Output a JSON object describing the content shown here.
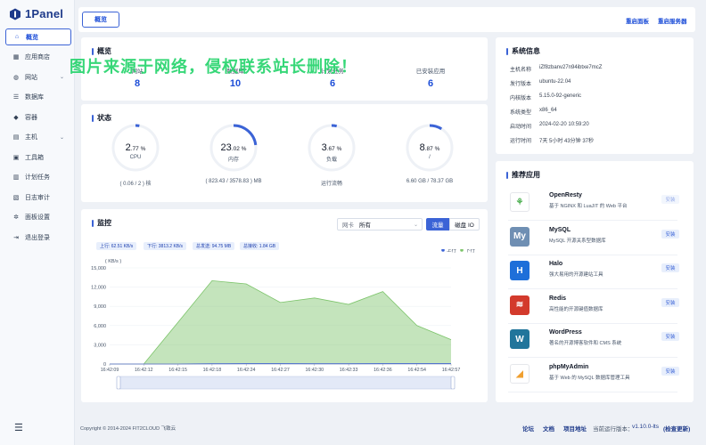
{
  "brand": {
    "name": "1Panel",
    "accent": "#3b63d6"
  },
  "sidebar": {
    "items": [
      {
        "label": "概览",
        "icon": "home-icon",
        "active": true
      },
      {
        "label": "应用商店",
        "icon": "store-icon"
      },
      {
        "label": "网站",
        "icon": "globe-icon",
        "expandable": true
      },
      {
        "label": "数据库",
        "icon": "database-icon"
      },
      {
        "label": "容器",
        "icon": "docker-icon"
      },
      {
        "label": "主机",
        "icon": "host-icon",
        "expandable": true
      },
      {
        "label": "工具箱",
        "icon": "toolbox-icon"
      },
      {
        "label": "计划任务",
        "icon": "calendar-icon"
      },
      {
        "label": "日志审计",
        "icon": "log-icon"
      },
      {
        "label": "面板设置",
        "icon": "gear-icon"
      },
      {
        "label": "退出登录",
        "icon": "logout-icon"
      }
    ]
  },
  "topbar": {
    "tab": "概览",
    "restart_panel": "重启面板",
    "restart_server": "重启服务器"
  },
  "overview": {
    "title": "概览",
    "items": [
      {
        "label": "网站",
        "value": "8"
      },
      {
        "label": "数据库",
        "value": "10"
      },
      {
        "label": "计划任务",
        "value": "6"
      },
      {
        "label": "已安装应用",
        "value": "6"
      }
    ]
  },
  "watermark": "图片来源于网络，侵权联系站长删除！",
  "status": {
    "title": "状态",
    "gauges": [
      {
        "int": "2",
        "dec": ".77",
        "unit": " %",
        "label": "CPU",
        "sub": "( 0.06 / 2 ) 核",
        "percent": 2.77
      },
      {
        "int": "23",
        "dec": ".02",
        "unit": " %",
        "label": "内存",
        "sub": "( 823.43 / 3578.83 ) MB",
        "percent": 23.02
      },
      {
        "int": "3",
        "dec": ".67",
        "unit": " %",
        "label": "负载",
        "sub": "运行流畅",
        "percent": 3.67
      },
      {
        "int": "8",
        "dec": ".87",
        "unit": " %",
        "label": "/",
        "sub": "6.60 GB / 78.37 GB",
        "percent": 8.87
      }
    ]
  },
  "system": {
    "title": "系统信息",
    "rows": [
      {
        "k": "主机名称",
        "v": "iZf8zbanv27n94ibtxe7mcZ"
      },
      {
        "k": "发行版本",
        "v": "ubuntu-22.04"
      },
      {
        "k": "内核版本",
        "v": "5.15.0-92-generic"
      },
      {
        "k": "系统类型",
        "v": "x86_64"
      },
      {
        "k": "启动时间",
        "v": "2024-02-20 10:59:20"
      },
      {
        "k": "运行时间",
        "v": "7天 5小时 43分钟 37秒"
      }
    ]
  },
  "apps": {
    "title": "推荐应用",
    "items": [
      {
        "name": "OpenResty",
        "desc": "基于 NGINX 和 LuaJIT 的 Web 平台",
        "icon": "openresty-icon",
        "color": "#ffffff",
        "glyph": "⚘",
        "glyph_color": "#4caf50",
        "btn": "安装",
        "btn_state": "disabled"
      },
      {
        "name": "MySQL",
        "desc": "MySQL 开源关系型数据库",
        "icon": "mysql-icon",
        "color": "#6f8fb3",
        "glyph": "My",
        "glyph_color": "#ffffff",
        "btn": "安装",
        "btn_state": "enabled"
      },
      {
        "name": "Halo",
        "desc": "强大易用的开源建站工具",
        "icon": "halo-icon",
        "color": "#1e6fd9",
        "glyph": "H",
        "glyph_color": "#ffffff",
        "btn": "安装",
        "btn_state": "enabled"
      },
      {
        "name": "Redis",
        "desc": "高性能的开源键值数据库",
        "icon": "redis-icon",
        "color": "#d33a2c",
        "glyph": "≋",
        "glyph_color": "#ffffff",
        "btn": "安装",
        "btn_state": "enabled"
      },
      {
        "name": "WordPress",
        "desc": "著名的开源博客软件和 CMS 系统",
        "icon": "wordpress-icon",
        "color": "#21759b",
        "glyph": "W",
        "glyph_color": "#ffffff",
        "btn": "安装",
        "btn_state": "enabled"
      },
      {
        "name": "phpMyAdmin",
        "desc": "基于 Web 的 MySQL 数据库管理工具",
        "icon": "phpmyadmin-icon",
        "color": "#ffffff",
        "glyph": "◢",
        "glyph_color": "#f0a030",
        "btn": "安装",
        "btn_state": "enabled"
      }
    ]
  },
  "monitor": {
    "title": "监控",
    "nic_label": "网卡",
    "nic_value": "所有",
    "tab_traffic": "流量",
    "tab_disk": "磁盘 IO",
    "tags": [
      "上行: 62.51 KB/s",
      "下行: 3813.2 KB/s",
      "总发送: 94.75 MB",
      "总接收: 1.84 GB"
    ]
  },
  "chart_data": {
    "type": "area",
    "ylabel": "( KB/s )",
    "ylim": [
      0,
      15000
    ],
    "yticks": [
      0,
      3000,
      6000,
      9000,
      12000,
      15000
    ],
    "x": [
      "16:42:09",
      "16:42:12",
      "16:42:15",
      "16:42:18",
      "16:42:24",
      "16:42:27",
      "16:42:30",
      "16:42:33",
      "16:42:36",
      "16:42:54",
      "16:42:57"
    ],
    "series": [
      {
        "name": "上行",
        "color": "#3b63d6",
        "values": [
          0,
          0,
          0,
          40,
          60,
          60,
          50,
          50,
          60,
          60,
          60
        ]
      },
      {
        "name": "下行",
        "color": "#7cc46a",
        "values": [
          0,
          0,
          6500,
          13000,
          12500,
          9600,
          10300,
          9300,
          11300,
          6000,
          3800
        ]
      }
    ],
    "legend": "top-right"
  },
  "footer": {
    "copyright": "Copyright © 2014-2024 FIT2CLOUD 飞致云",
    "forum": "论坛",
    "docs": "文档",
    "project": "项目地址",
    "version_label": "当前运行版本：",
    "version": "v1.10.0-lts",
    "check_update": "(检查更新)"
  }
}
